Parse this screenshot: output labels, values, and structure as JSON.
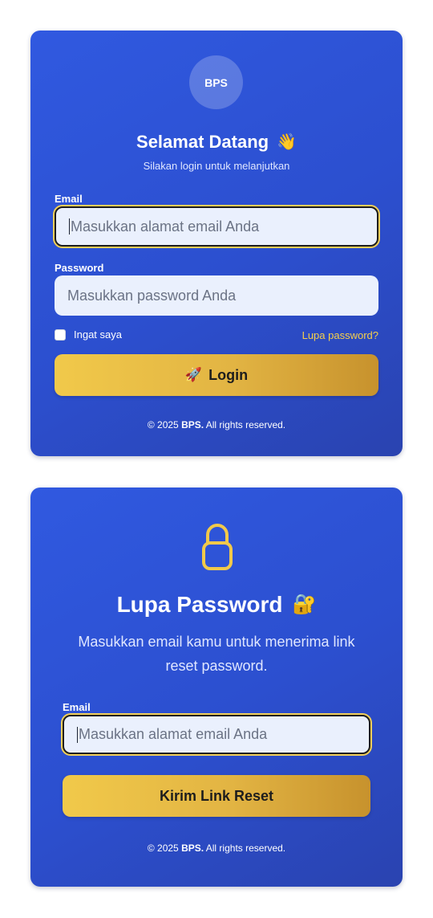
{
  "login": {
    "logo_text": "BPS",
    "title": "Selamat Datang",
    "title_emoji": "👋",
    "subtitle": "Silakan login untuk melanjutkan",
    "email_label": "Email",
    "email_placeholder": "Masukkan alamat email Anda",
    "password_label": "Password",
    "password_placeholder": "Masukkan password Anda",
    "remember_label": "Ingat saya",
    "forgot_link": "Lupa password?",
    "button_emoji": "🚀",
    "button_label": "Login",
    "footer_prefix": "© 2025 ",
    "footer_brand": "BPS.",
    "footer_suffix": " All rights reserved."
  },
  "forgot": {
    "icon": "lock-icon",
    "title": "Lupa Password",
    "title_emoji": "🔐",
    "description": "Masukkan email kamu untuk menerima link reset password.",
    "email_label": "Email",
    "email_placeholder": "Masukkan alamat email Anda",
    "button_label": "Kirim Link Reset",
    "footer_prefix": "© 2025 ",
    "footer_brand": "BPS.",
    "footer_suffix": " All rights reserved."
  },
  "colors": {
    "card_gradient_start": "#3059e0",
    "card_gradient_end": "#2a43b0",
    "accent_gold": "#f1c94a",
    "input_bg": "#eaf0fd",
    "link_color": "#f6cf4b"
  }
}
